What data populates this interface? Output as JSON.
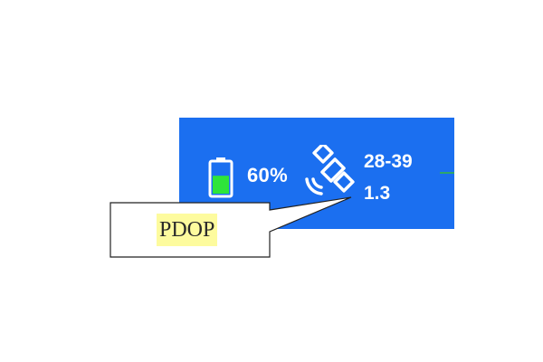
{
  "status_bar": {
    "background": "#1b6ff0",
    "battery": {
      "icon": "battery-icon",
      "level": 0.6,
      "fill_color": "#2ee53a",
      "text": "60%"
    },
    "satellite": {
      "icon": "satellite-icon",
      "count_text": "28-39",
      "pdop_text": "1.3"
    }
  },
  "callout": {
    "label": "PDOP",
    "highlight_color": "#fdfb9e"
  }
}
